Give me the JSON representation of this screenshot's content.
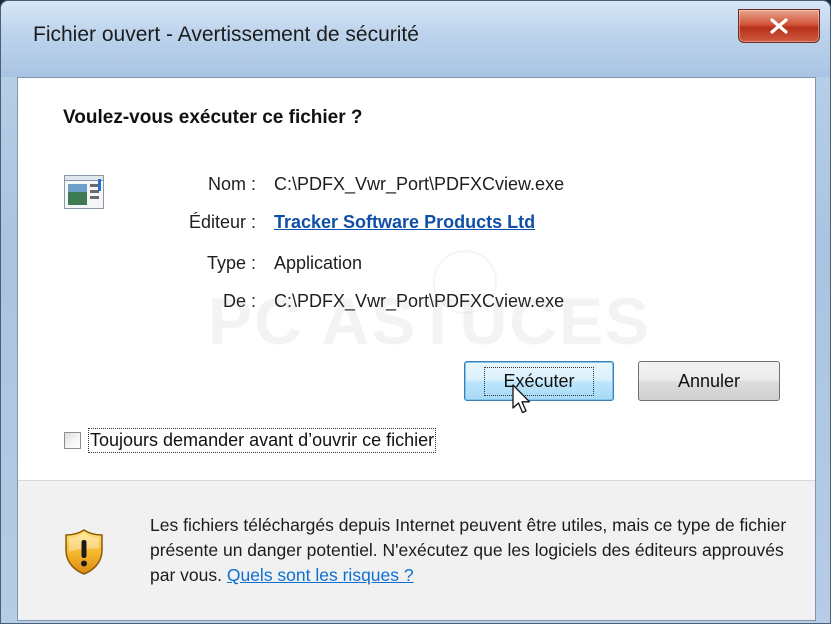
{
  "window": {
    "title": "Fichier ouvert - Avertissement de sécurité",
    "close_label": "x"
  },
  "dialog": {
    "question": "Voulez-vous exécuter ce fichier ?",
    "fields": {
      "name_label": "Nom :",
      "name_value": "C:\\PDFX_Vwr_Port\\PDFXCview.exe",
      "publisher_label": "Éditeur :",
      "publisher_value": "Tracker Software Products Ltd",
      "type_label": "Type :",
      "type_value": "Application",
      "from_label": "De :",
      "from_value": "C:\\PDFX_Vwr_Port\\PDFXCview.exe"
    },
    "watermark": "PC ASTUCES",
    "buttons": {
      "run_label": "Exécuter",
      "cancel_label": "Annuler"
    },
    "checkbox": {
      "label": "Toujours demander avant d’ouvrir ce fichier",
      "checked": false
    }
  },
  "footer": {
    "warning_text": "Les fichiers téléchargés depuis Internet peuvent être utiles, mais ce type de fichier présente un danger potentiel. N'exécutez que les logiciels des éditeurs approuvés par vous.",
    "risk_link": "Quels sont les risques ?"
  },
  "colors": {
    "link": "#0f4fa8",
    "close_button": "#c8462c",
    "default_button": "#bee6fd"
  },
  "icons": {
    "app": "application-window-icon",
    "shield": "security-shield-warning-icon",
    "close": "close-x-icon",
    "cursor": "mouse-pointer-icon"
  }
}
